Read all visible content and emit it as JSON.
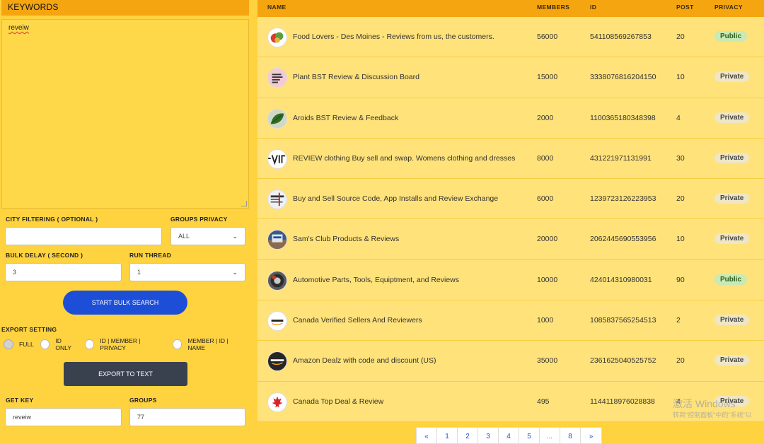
{
  "keywords": {
    "header": "KEYWORDS",
    "value": "reveiw"
  },
  "city_filter": {
    "label": "CITY FILTERING ( OPTIONAL )",
    "value": ""
  },
  "groups_privacy": {
    "label": "GROUPS PRIVACY",
    "value": "ALL"
  },
  "bulk_delay": {
    "label": "BULK DELAY ( SECOND )",
    "value": "3"
  },
  "run_thread": {
    "label": "RUN THREAD",
    "value": "1"
  },
  "start_button": "START BULK SEARCH",
  "export": {
    "label": "EXPORT SETTING",
    "options": [
      "FULL",
      "ID ONLY",
      "ID | MEMBER | PRIVACY",
      "MEMBER | ID | NAME"
    ],
    "button": "EXPORT TO TEXT"
  },
  "get_key": {
    "label": "GET KEY",
    "value": "reveiw"
  },
  "groups": {
    "label": "GROUPS",
    "value": "77"
  },
  "table": {
    "headers": {
      "name": "NAME",
      "members": "MEMBERS",
      "id": "ID",
      "post": "POST",
      "privacy": "PRIVACY"
    },
    "rows": [
      {
        "name": "Food Lovers - Des Moines - Reviews from us, the customers.",
        "members": "56000",
        "id": "541108569267853",
        "post": "20",
        "privacy": "Public",
        "avatar": "food-icon"
      },
      {
        "name": "Plant BST Review & Discussion Board",
        "members": "15000",
        "id": "3338076816204150",
        "post": "10",
        "privacy": "Private",
        "avatar": "plant-text-icon"
      },
      {
        "name": "Aroids BST Review & Feedback",
        "members": "2000",
        "id": "1100365180348398",
        "post": "4",
        "privacy": "Private",
        "avatar": "leaf-icon"
      },
      {
        "name": "REVIEW clothing Buy sell and swap. Womens clothing and dresses",
        "members": "8000",
        "id": "431221971131991",
        "post": "30",
        "privacy": "Private",
        "avatar": "review-text-icon"
      },
      {
        "name": "Buy and Sell Source Code, App Installs and Review Exchange",
        "members": "6000",
        "id": "1239723126223953",
        "post": "20",
        "privacy": "Private",
        "avatar": "code-icon"
      },
      {
        "name": "Sam's Club Products & Reviews",
        "members": "20000",
        "id": "2062445690553956",
        "post": "10",
        "privacy": "Private",
        "avatar": "store-icon"
      },
      {
        "name": "Automotive Parts, Tools, Equiptment, and Reviews",
        "members": "10000",
        "id": "424014310980031",
        "post": "90",
        "privacy": "Public",
        "avatar": "auto-parts-icon"
      },
      {
        "name": "Canada Verified Sellers And Reviewers",
        "members": "1000",
        "id": "1085837565254513",
        "post": "2",
        "privacy": "Private",
        "avatar": "amazon-ca-icon"
      },
      {
        "name": "Amazon Dealz with code and discount (US)",
        "members": "35000",
        "id": "2361625040525752",
        "post": "20",
        "privacy": "Private",
        "avatar": "amazon-icon"
      },
      {
        "name": "Canada Top Deal & Review",
        "members": "495",
        "id": "1144118976028838",
        "post": "4",
        "privacy": "Private",
        "avatar": "maple-leaf-icon"
      }
    ]
  },
  "pagination": [
    "«",
    "1",
    "2",
    "3",
    "4",
    "5",
    "...",
    "8",
    "»"
  ],
  "watermark": {
    "line1": "激活 Windows",
    "line2": "转到\"控制面板\"中的\"系统\"以"
  },
  "colors": {
    "panel": "#ffd23f",
    "header": "#f5a50f",
    "row": "#ffe27a",
    "primary_button": "#1d4ed8",
    "dark_button": "#3a414e",
    "public_badge": "#c9e9b5"
  }
}
